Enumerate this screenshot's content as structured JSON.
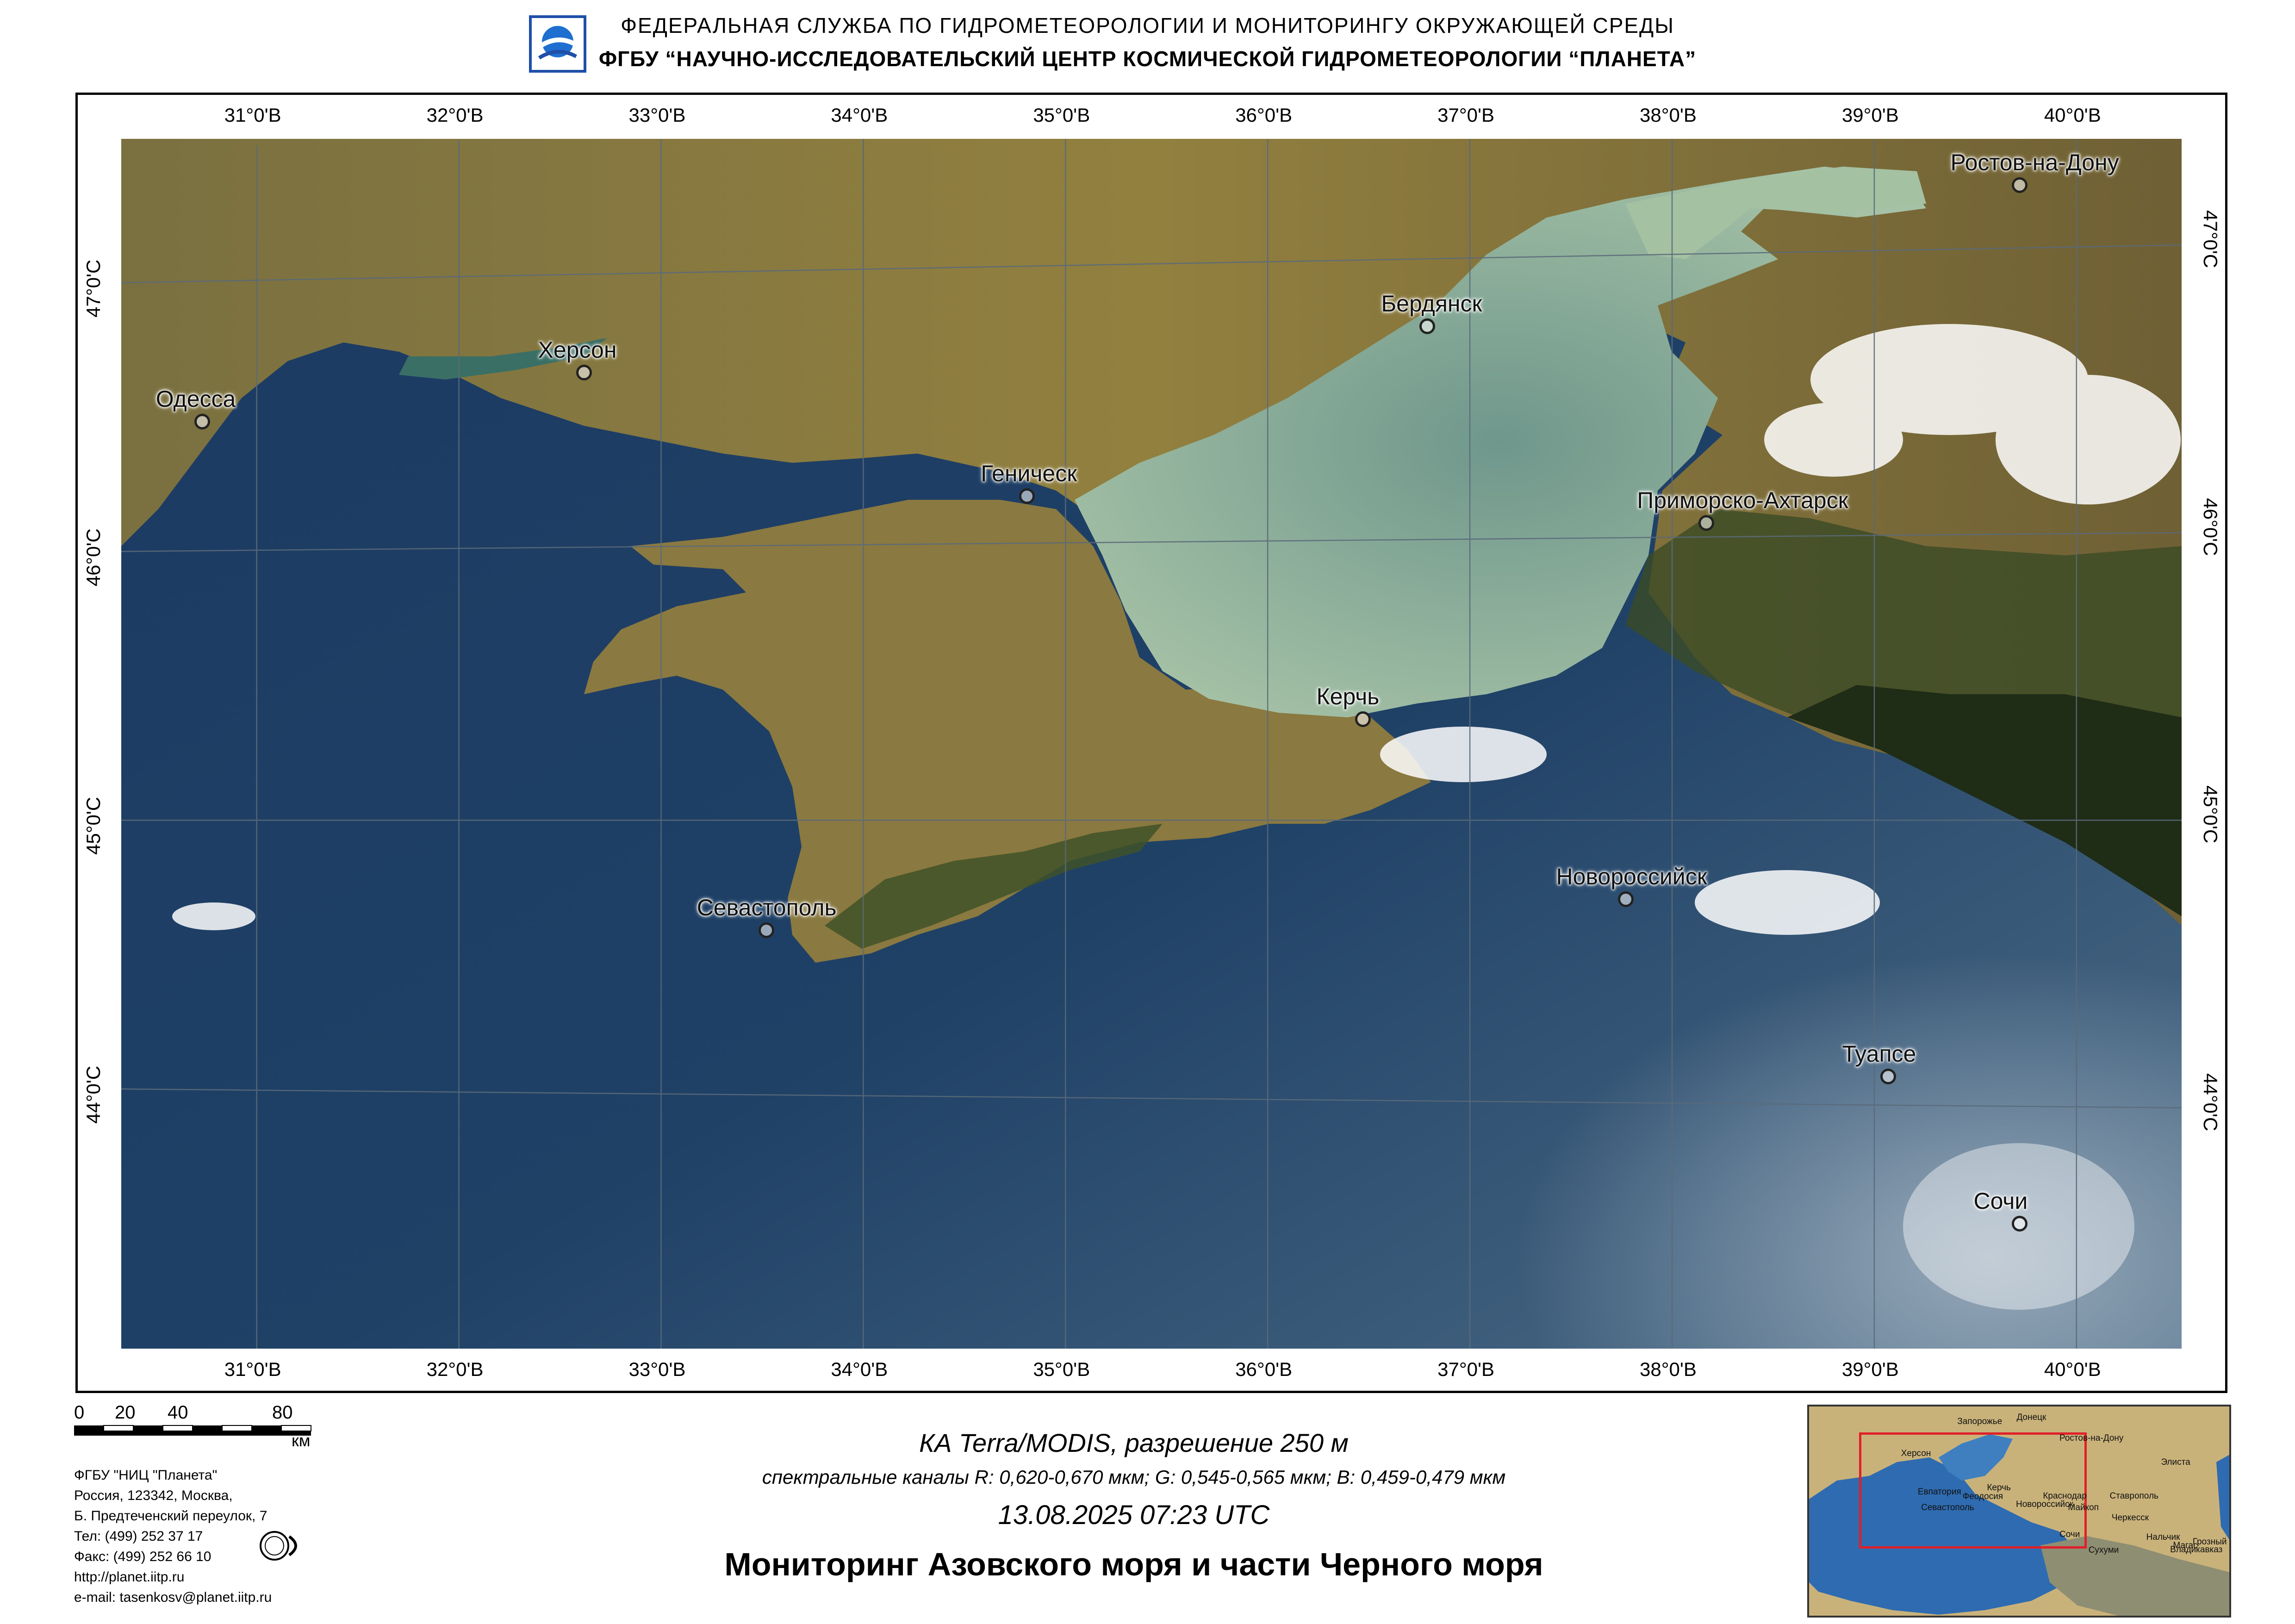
{
  "header": {
    "line1": "ФЕДЕРАЛЬНАЯ  СЛУЖБА  ПО ГИДРОМЕТЕОРОЛОГИИ И МОНИТОРИНГУ ОКРУЖАЮЩЕЙ СРЕДЫ",
    "line2": "ФГБУ “НАУЧНО-ИССЛЕДОВАТЕЛЬСКИЙ ЦЕНТР КОСМИЧЕСКОЙ ГИДРОМЕТЕОРОЛОГИИ “ПЛАНЕТА”"
  },
  "grid": {
    "top_lon_labels": [
      "31°0'В",
      "32°0'В",
      "33°0'В",
      "34°0'В",
      "35°0'В",
      "36°0'В",
      "37°0'В",
      "38°0'В",
      "39°0'В",
      "40°0'В"
    ],
    "bottom_lon_labels": [
      "31°0'В",
      "32°0'В",
      "33°0'В",
      "34°0'В",
      "35°0'В",
      "36°0'В",
      "37°0'В",
      "38°0'В",
      "39°0'В",
      "40°0'В"
    ],
    "left_lat_labels": [
      "47°0'С",
      "46°0'С",
      "45°0'С",
      "44°0'С"
    ],
    "right_lat_labels": [
      "47°0'С",
      "46°0'С",
      "45°0'С",
      "44°0'С"
    ]
  },
  "cities": [
    {
      "name": "Одесса",
      "lon": 30.73,
      "lat": 46.48
    },
    {
      "name": "Херсон",
      "lon": 32.62,
      "lat": 46.64
    },
    {
      "name": "Геническ",
      "lon": 34.81,
      "lat": 46.17
    },
    {
      "name": "Бердянск",
      "lon": 36.79,
      "lat": 46.76
    },
    {
      "name": "Ростов-на-Дону",
      "lon": 39.72,
      "lat": 47.22
    },
    {
      "name": "Приморско-Ахтарск",
      "lon": 38.17,
      "lat": 46.05
    },
    {
      "name": "Керчь",
      "lon": 36.47,
      "lat": 45.36
    },
    {
      "name": "Новороссийск",
      "lon": 37.77,
      "lat": 44.72
    },
    {
      "name": "Севастополь",
      "lon": 33.52,
      "lat": 44.6
    },
    {
      "name": "Туапсе",
      "lon": 39.07,
      "lat": 44.1
    },
    {
      "name": "Сочи",
      "lon": 39.72,
      "lat": 43.59
    }
  ],
  "scale_bar": {
    "ticks": [
      "0",
      "20",
      "40",
      "80"
    ],
    "unit": "км"
  },
  "org_info": [
    "ФГБУ \"НИЦ \"Планета\"",
    "Россия, 123342,  Москва,",
    "Б. Предтеченский переулок, 7",
    "Тел: (499) 252 37 17",
    "Факс: (499) 252 66 10",
    "http://planet.iitp.ru",
    "e-mail: tasenkosv@planet.iitp.ru"
  ],
  "satellite_line": "КА Terra/MODIS, разрешение 250 м",
  "bands_line": "спектральные каналы R: 0,620-0,670 мкм; G: 0,545-0,565 мкм;  B: 0,459-0,479 мкм",
  "datetime": "13.08.2025    07:23 UTC",
  "title": "Мониторинг Азовского моря и части Черного моря",
  "inset_labels": [
    {
      "text": "Запорожье",
      "lon": 35.14,
      "lat": 47.84
    },
    {
      "text": "Донецк",
      "lon": 37.8,
      "lat": 48.0
    },
    {
      "text": "Херсон",
      "lon": 32.62,
      "lat": 46.64
    },
    {
      "text": "Ростов-на-Дону",
      "lon": 39.72,
      "lat": 47.22
    },
    {
      "text": "Элиста",
      "lon": 44.27,
      "lat": 46.31
    },
    {
      "text": "Евпатория",
      "lon": 33.37,
      "lat": 45.19
    },
    {
      "text": "Феодосия",
      "lon": 35.38,
      "lat": 45.03
    },
    {
      "text": "Керчь",
      "lon": 36.47,
      "lat": 45.36
    },
    {
      "text": "Краснодар",
      "lon": 38.98,
      "lat": 45.04
    },
    {
      "text": "Ставрополь",
      "lon": 41.97,
      "lat": 45.04
    },
    {
      "text": "Севастополь",
      "lon": 33.52,
      "lat": 44.6
    },
    {
      "text": "Майкоп",
      "lon": 40.1,
      "lat": 44.61
    },
    {
      "text": "Новороссийск",
      "lon": 37.77,
      "lat": 44.72
    },
    {
      "text": "Черкесск",
      "lon": 42.06,
      "lat": 44.23
    },
    {
      "text": "Сочи",
      "lon": 39.72,
      "lat": 43.59
    },
    {
      "text": "Нальчик",
      "lon": 43.61,
      "lat": 43.49
    },
    {
      "text": "Владикавказ",
      "lon": 44.68,
      "lat": 43.02
    },
    {
      "text": "Магас",
      "lon": 44.81,
      "lat": 43.17
    },
    {
      "text": "Грозный",
      "lon": 45.69,
      "lat": 43.32
    },
    {
      "text": "Сухуми",
      "lon": 41.02,
      "lat": 43.0
    }
  ],
  "colors": {
    "sea_deep": "#1d3d63",
    "sea_azov": "#7fa596",
    "land": "#8d7a45",
    "forest": "#2f3a20",
    "inset_extent": "#e0202a"
  }
}
